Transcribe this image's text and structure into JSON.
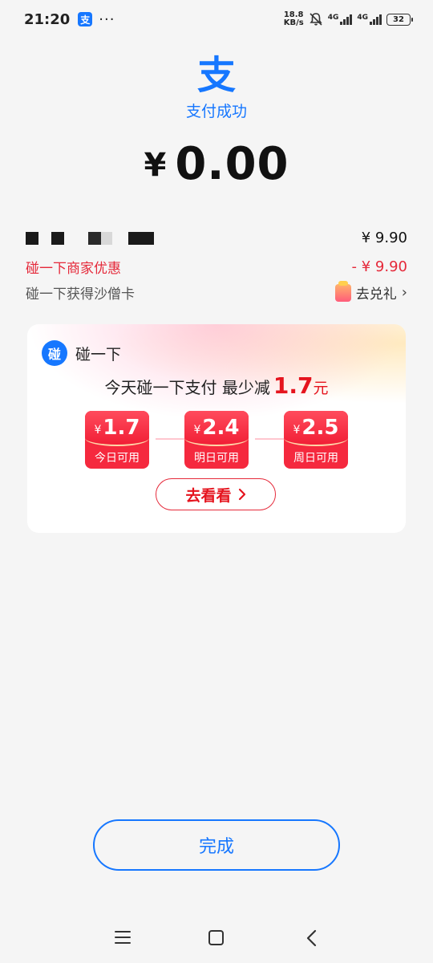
{
  "status_bar": {
    "time": "21:20",
    "app_badge": "支",
    "more": "···",
    "speed_value": "18.8",
    "speed_unit": "KB/s",
    "net1": "4G",
    "net2": "4G",
    "battery": "32"
  },
  "header": {
    "logo_char": "支",
    "status": "支付成功",
    "currency": "¥",
    "amount": "0.00"
  },
  "details": {
    "merchant_price": "¥ 9.90",
    "discount_label": "碰一下商家优惠",
    "discount_value": "- ¥ 9.90",
    "gift_label": "碰一下获得沙僧卡",
    "gift_link": "去兑礼"
  },
  "card": {
    "brand_icon": "碰",
    "brand_name": "碰一下",
    "promo_text": "今天碰一下支付 最少减",
    "promo_value": "1.7",
    "promo_unit": "元",
    "coupons": [
      {
        "currency": "¥",
        "value": "1.7",
        "label": "今日可用"
      },
      {
        "currency": "¥",
        "value": "2.4",
        "label": "明日可用"
      },
      {
        "currency": "¥",
        "value": "2.5",
        "label": "周日可用"
      }
    ],
    "cta": "去看看"
  },
  "footer": {
    "done": "完成"
  },
  "colors": {
    "brand_blue": "#1677ff",
    "discount_red": "#e5293a",
    "coupon_red": "#f5293e"
  },
  "icons": [
    "alipay-logo-icon",
    "bell-off-icon",
    "signal-icon",
    "battery-icon",
    "gift-icon",
    "chevron-right-icon",
    "menu-icon",
    "home-icon",
    "back-icon"
  ]
}
